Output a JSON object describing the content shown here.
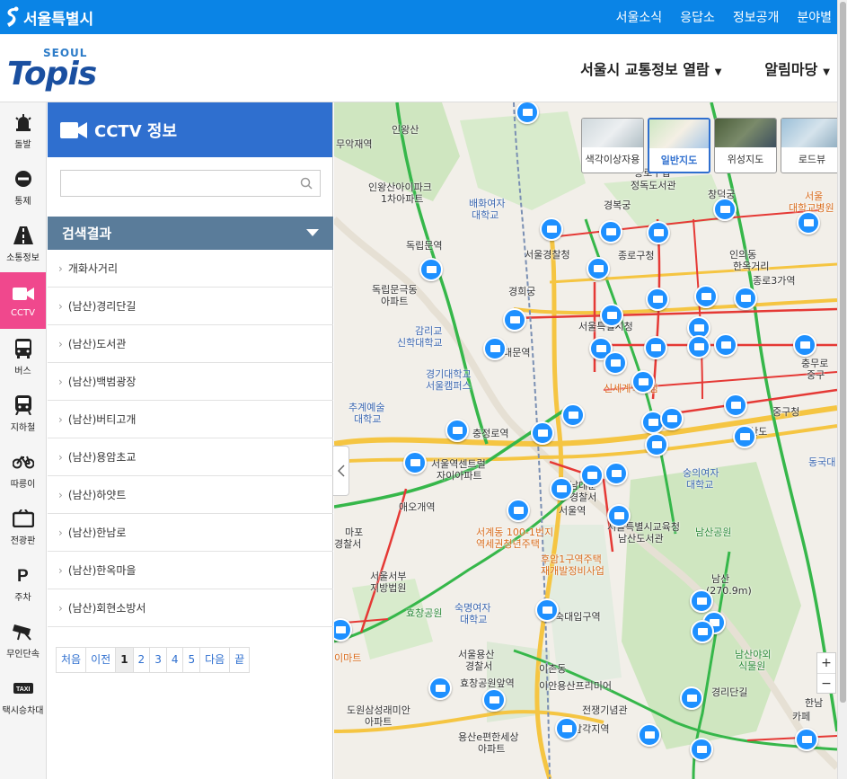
{
  "topbar": {
    "seoul_logo": "서울특별시",
    "links": [
      "서울소식",
      "응답소",
      "정보공개",
      "분야별"
    ]
  },
  "brand": {
    "seoul": "SEOUL",
    "topis": "Topis"
  },
  "main_nav": [
    {
      "label": "서울시 교통정보 열람"
    },
    {
      "label": "알림마당"
    }
  ],
  "sidebar": [
    {
      "label": "돌발",
      "icon": "siren-icon"
    },
    {
      "label": "통제",
      "icon": "no-entry-icon"
    },
    {
      "label": "소통정보",
      "icon": "road-icon"
    },
    {
      "label": "CCTV",
      "icon": "camera-icon",
      "active": true
    },
    {
      "label": "버스",
      "icon": "bus-icon"
    },
    {
      "label": "지하철",
      "icon": "subway-icon"
    },
    {
      "label": "따릉이",
      "icon": "bicycle-icon"
    },
    {
      "label": "전광판",
      "icon": "billboard-icon"
    },
    {
      "label": "주차",
      "icon": "parking-icon"
    },
    {
      "label": "무인단속",
      "icon": "speed-camera-icon"
    },
    {
      "label": "택시승차대",
      "icon": "taxi-icon"
    }
  ],
  "panel": {
    "title": "CCTV 정보",
    "search_value": "",
    "results_header": "검색결과",
    "results": [
      "개화사거리",
      "(남산)경리단길",
      "(남산)도서관",
      "(남산)백범광장",
      "(남산)버티고개",
      "(남산)용암초교",
      "(남산)하얏트",
      "(남산)한남로",
      "(남산)한옥마을",
      "(남산)회현소방서"
    ],
    "pager": [
      "처음",
      "이전",
      "1",
      "2",
      "3",
      "4",
      "5",
      "다음",
      "끝"
    ],
    "current_page": "1"
  },
  "map": {
    "map_types": [
      {
        "label": "색각이상자용",
        "selected": false
      },
      {
        "label": "일반지도",
        "selected": true
      },
      {
        "label": "위성지도",
        "selected": false
      },
      {
        "label": "로드뷰",
        "selected": false
      }
    ],
    "zoom_in": "+",
    "zoom_out": "−",
    "labels": [
      {
        "t": "인왕산",
        "c": ""
      },
      {
        "t": "무악재역",
        "c": ""
      },
      {
        "t": "인왕산아이파크",
        "c": ""
      },
      {
        "t": "1차아파트",
        "c": ""
      },
      {
        "t": "배화여자",
        "c": "blue"
      },
      {
        "t": "대학교",
        "c": "blue"
      },
      {
        "t": "경복궁",
        "c": ""
      },
      {
        "t": "종로구립",
        "c": ""
      },
      {
        "t": "정독도서관",
        "c": ""
      },
      {
        "t": "창덕궁",
        "c": ""
      },
      {
        "t": "서울",
        "c": "orange"
      },
      {
        "t": "대학교병원",
        "c": "orange"
      },
      {
        "t": "독립문역",
        "c": ""
      },
      {
        "t": "서울경찰청",
        "c": ""
      },
      {
        "t": "종로구청",
        "c": ""
      },
      {
        "t": "인의동",
        "c": ""
      },
      {
        "t": "한옥거리",
        "c": ""
      },
      {
        "t": "종로3가역",
        "c": ""
      },
      {
        "t": "경희궁",
        "c": ""
      },
      {
        "t": "독립문극동",
        "c": ""
      },
      {
        "t": "아파트",
        "c": ""
      },
      {
        "t": "감리교",
        "c": "blue"
      },
      {
        "t": "신학대학교",
        "c": "blue"
      },
      {
        "t": "서울특별시청",
        "c": ""
      },
      {
        "t": "서대문역",
        "c": ""
      },
      {
        "t": "경기대학교",
        "c": "blue"
      },
      {
        "t": "서울캠퍼스",
        "c": "blue"
      },
      {
        "t": "추계예술",
        "c": "blue"
      },
      {
        "t": "대학교",
        "c": "blue"
      },
      {
        "t": "충정로역",
        "c": ""
      },
      {
        "t": "신세계백화점",
        "c": "orange"
      },
      {
        "t": "서울역센트럴",
        "c": ""
      },
      {
        "t": "자이아파트",
        "c": ""
      },
      {
        "t": "애오개역",
        "c": ""
      },
      {
        "t": "서울역",
        "c": ""
      },
      {
        "t": "남대문",
        "c": ""
      },
      {
        "t": "경찰서",
        "c": ""
      },
      {
        "t": "숭의여자",
        "c": "blue"
      },
      {
        "t": "대학교",
        "c": "blue"
      },
      {
        "t": "서울특별시교육청",
        "c": ""
      },
      {
        "t": "남산도서관",
        "c": ""
      },
      {
        "t": "남산공원",
        "c": "green"
      },
      {
        "t": "서계동 100-1번지",
        "c": "orange"
      },
      {
        "t": "역세권청년주택",
        "c": "orange"
      },
      {
        "t": "후암1구역주택",
        "c": "orange"
      },
      {
        "t": "재개발정비사업",
        "c": "orange"
      },
      {
        "t": "마포",
        "c": ""
      },
      {
        "t": "경찰서",
        "c": ""
      },
      {
        "t": "서울서부",
        "c": ""
      },
      {
        "t": "지방법원",
        "c": ""
      },
      {
        "t": "숙명여자",
        "c": "blue"
      },
      {
        "t": "대학교",
        "c": "blue"
      },
      {
        "t": "효창공원",
        "c": "green"
      },
      {
        "t": "숙대입구역",
        "c": ""
      },
      {
        "t": "남산",
        "c": ""
      },
      {
        "t": "(270.9m)",
        "c": ""
      },
      {
        "t": "서울용산",
        "c": ""
      },
      {
        "t": "경찰서",
        "c": ""
      },
      {
        "t": "효창공원앞역",
        "c": ""
      },
      {
        "t": "이촌동",
        "c": ""
      },
      {
        "t": "이안용산프리미어",
        "c": ""
      },
      {
        "t": "전쟁기념관",
        "c": ""
      },
      {
        "t": "도원삼성래미안",
        "c": ""
      },
      {
        "t": "아파트",
        "c": ""
      },
      {
        "t": "용산e편한세상",
        "c": ""
      },
      {
        "t": "아파트",
        "c": ""
      },
      {
        "t": "삼각지역",
        "c": ""
      },
      {
        "t": "경리단길",
        "c": ""
      },
      {
        "t": "남산야외",
        "c": "green"
      },
      {
        "t": "식물원",
        "c": "green"
      },
      {
        "t": "한남",
        "c": ""
      },
      {
        "t": "카페",
        "c": ""
      },
      {
        "t": "이마트",
        "c": "orange"
      },
      {
        "t": "충무로",
        "c": ""
      },
      {
        "t": "중구",
        "c": ""
      },
      {
        "t": "중구청",
        "c": ""
      },
      {
        "t": "남산도",
        "c": ""
      },
      {
        "t": "동국대",
        "c": "blue"
      }
    ]
  }
}
